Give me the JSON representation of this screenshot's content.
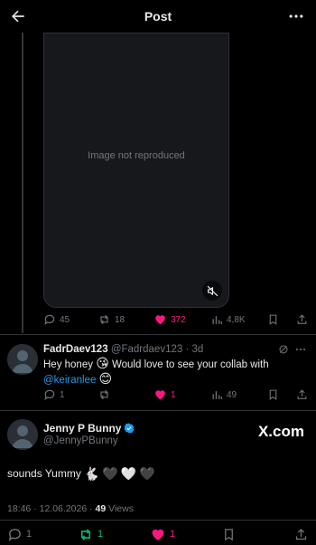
{
  "header": {
    "title": "Post"
  },
  "media": {
    "note": "Image not reproduced"
  },
  "main_post_actions": {
    "replies": "45",
    "reposts": "18",
    "likes": "372",
    "views": "4,8K"
  },
  "reply": {
    "name": "FadrDaev123",
    "handle": "@Fadrdaev123",
    "separator": "·",
    "time": "3d",
    "text_start": "Hey honey ",
    "emoji_kiss": "😘",
    "text_mid": " Would love to see your collab with",
    "mention": "@keiranlee",
    "emoji_smile": "😊",
    "actions": {
      "replies": "1",
      "reposts": "",
      "likes": "1",
      "views": "49"
    }
  },
  "focused_post": {
    "name": "Jenny P Bunny",
    "handle": "@JennyPBunny",
    "watermark": "X.com",
    "text": "sounds Yummy",
    "emojis": [
      "🐇",
      "🖤",
      "🤍",
      "🖤"
    ],
    "time": "18:46",
    "dot": "·",
    "date": "12.06.2026",
    "dot2": "·",
    "views_count": "49",
    "views_label": "Views",
    "actions": {
      "replies": "1",
      "reposts": "1",
      "likes": "1"
    }
  },
  "colors": {
    "background": "#000000",
    "text": "#e7e9ea",
    "muted": "#71767b",
    "like_active": "#f91880",
    "repost_active": "#00ba7c",
    "link": "#1d9bf0",
    "divider": "#2f3336",
    "verified": "#1d9bf0"
  },
  "icons": {
    "back": "arrow-left-icon",
    "more": "more-horizontal-icon",
    "reply": "comment-icon",
    "repost": "repost-icon",
    "like": "heart-icon",
    "views": "analytics-icon",
    "bookmark": "bookmark-icon",
    "share": "share-icon",
    "mute": "muted-speaker-icon",
    "verified": "verified-badge-icon",
    "grok": "grok-icon"
  }
}
